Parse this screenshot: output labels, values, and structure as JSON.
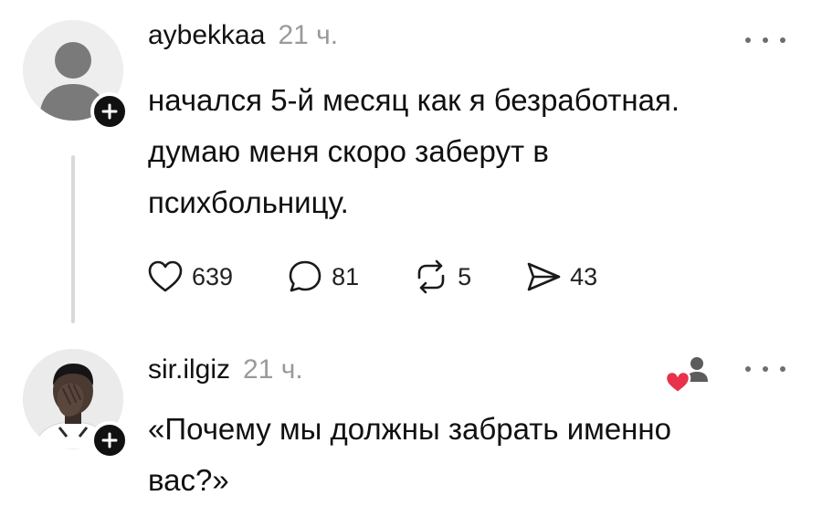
{
  "posts": [
    {
      "username": "aybekkaa",
      "time": "21 ч.",
      "text": "начался 5-й месяц как я безработная.\nдумаю меня скоро заберут в\nпсихбольницу.",
      "actions": {
        "likes": "639",
        "comments": "81",
        "reposts": "5",
        "shares": "43"
      },
      "avatar": "default-avatar-icon"
    },
    {
      "username": "sir.ilgiz",
      "time": "21 ч.",
      "text": "«Почему мы должны забрать именно\nвас?»",
      "avatar": "profile-photo"
    }
  ],
  "colors": {
    "text": "#101010",
    "muted": "#9a9a9a",
    "thread_line": "#d9d9d9",
    "like_heart": "#e8314a"
  }
}
